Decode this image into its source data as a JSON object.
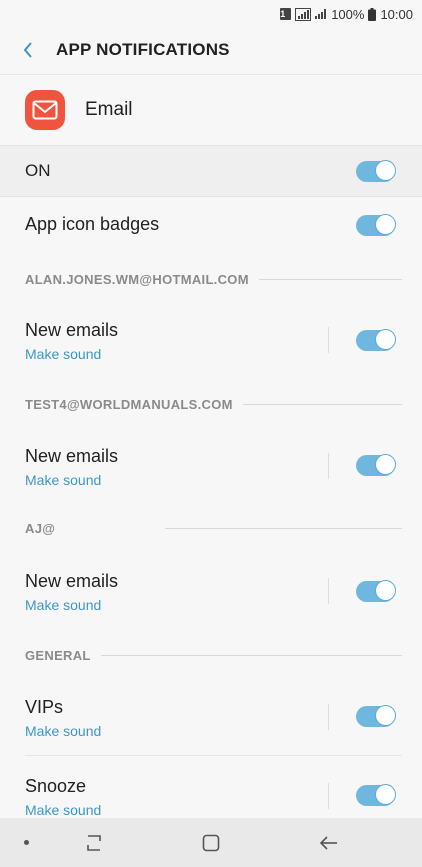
{
  "status_bar": {
    "sim": "1",
    "battery": "100%",
    "time": "10:00"
  },
  "header": {
    "title": "APP NOTIFICATIONS",
    "back_icon": "chevron-left-icon"
  },
  "app": {
    "name": "Email",
    "icon": "envelope-icon",
    "icon_color": "#f0543e"
  },
  "master": {
    "label": "ON",
    "enabled": true
  },
  "badges": {
    "label": "App icon badges",
    "enabled": true
  },
  "sections": [
    {
      "label": "ALAN.JONES.WM@HOTMAIL.COM",
      "items": [
        {
          "title": "New emails",
          "sub": "Make sound",
          "enabled": true
        }
      ]
    },
    {
      "label": "TEST4@WORLDMANUALS.COM",
      "items": [
        {
          "title": "New emails",
          "sub": "Make sound",
          "enabled": true
        }
      ]
    },
    {
      "label": "AJ@",
      "items": [
        {
          "title": "New emails",
          "sub": "Make sound",
          "enabled": true
        }
      ]
    },
    {
      "label": "GENERAL",
      "items": [
        {
          "title": "VIPs",
          "sub": "Make sound",
          "enabled": true
        },
        {
          "title": "Snooze",
          "sub": "Make sound",
          "enabled": true
        }
      ]
    }
  ],
  "colors": {
    "accent": "#3e97c7",
    "toggle_on": "#6fb7de"
  }
}
